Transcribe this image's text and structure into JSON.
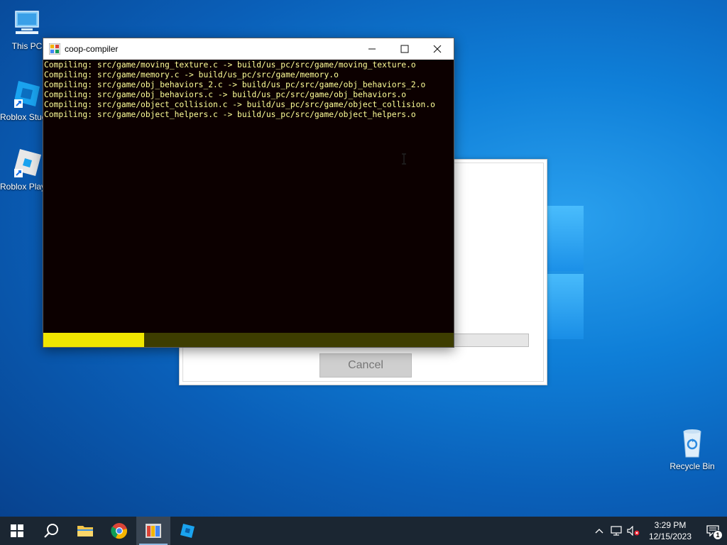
{
  "desktop": {
    "icons": [
      {
        "label": "This PC"
      },
      {
        "label": "Roblox Studio"
      },
      {
        "label": "Roblox Player"
      },
      {
        "label": "Recycle Bin"
      }
    ]
  },
  "back_dialog": {
    "cancel_label": "Cancel"
  },
  "terminal": {
    "title": "coop-compiler",
    "lines": [
      "Compiling: src/game/moving_texture.c -> build/us_pc/src/game/moving_texture.o",
      "Compiling: src/game/memory.c -> build/us_pc/src/game/memory.o",
      "Compiling: src/game/obj_behaviors_2.c -> build/us_pc/src/game/obj_behaviors_2.o",
      "Compiling: src/game/obj_behaviors.c -> build/us_pc/src/game/obj_behaviors.o",
      "Compiling: src/game/object_collision.c -> build/us_pc/src/game/object_collision.o",
      "Compiling: src/game/object_helpers.c -> build/us_pc/src/game/object_helpers.o"
    ],
    "progress_fraction": 0.245,
    "progress_fill_color": "#f0e600",
    "progress_track_color": "#3d3d00",
    "text_color": "#ffff99"
  },
  "taskbar": {
    "items": [
      "start-icon",
      "search-icon",
      "file-explorer-icon",
      "chrome-icon",
      "coop-compiler-icon",
      "roblox-studio-icon"
    ],
    "clock_time": "3:29 PM",
    "clock_date": "12/15/2023",
    "notification_count": "1"
  }
}
